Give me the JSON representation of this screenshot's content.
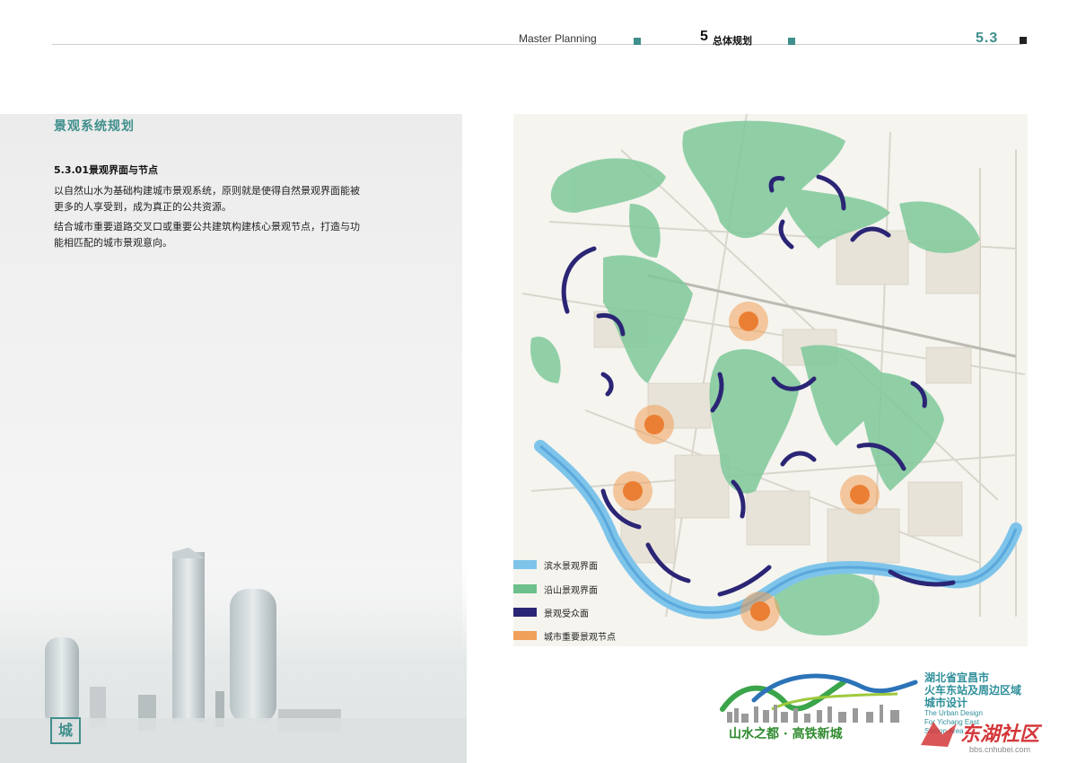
{
  "header": {
    "section_en": "Master Planning",
    "chapter_num": "5",
    "chapter_cn": "总体规划",
    "page_num": "5.3",
    "accent_color": "#3f8f8c"
  },
  "content": {
    "section_title": "景观系统规划",
    "sub_title": "5.3.01景观界面与节点",
    "paragraph1_line1": "以自然山水为基础构建城市景观系统，原则就是使得自然景观界面能被",
    "paragraph1_line2": "更多的人享受到，成为真正的公共资源。",
    "paragraph2_line1": "结合城市重要道路交叉口或重要公共建筑构建核心景观节点，打造与功",
    "paragraph2_line2": "能相匹配的城市景观意向。"
  },
  "legend": [
    {
      "label": "滨水景观界面",
      "color": "#7ec4ea"
    },
    {
      "label": "沿山景观界面",
      "color": "#6cc08a"
    },
    {
      "label": "景观受众面",
      "color": "#2b2575"
    },
    {
      "label": "城市重要景观节点",
      "color": "#f0a05a"
    }
  ],
  "brand": {
    "slogan": "山水之都 · 高铁新城",
    "project_line1": "湖北省宜昌市",
    "project_line2": "火车东站及周边区域",
    "project_line3": "城市设计",
    "project_en_line1": "The Urban Design",
    "project_en_line2": "For Yichang East",
    "project_en_line3": "Station Area"
  },
  "watermark": {
    "text": "东湖社区",
    "url": "bbs.cnhubei.com"
  },
  "logo_mark": "城"
}
